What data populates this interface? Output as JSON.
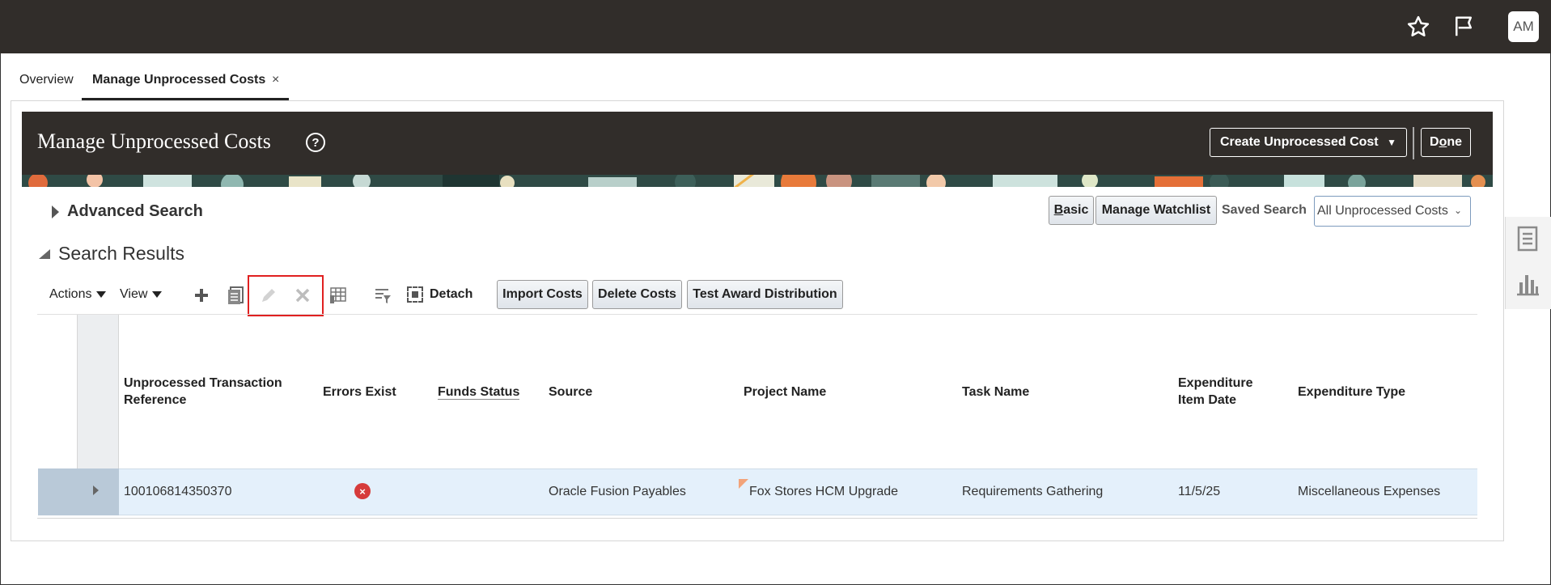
{
  "topbar": {
    "icons": [
      "star-icon",
      "flag-icon"
    ],
    "avatar_initials": "AM"
  },
  "tabs": [
    {
      "label": "Overview"
    },
    {
      "label": "Manage Unprocessed Costs",
      "active": true,
      "close": "×"
    }
  ],
  "page": {
    "title": "Manage Unprocessed Costs",
    "help": "?",
    "create_button": "Create Unprocessed Cost",
    "done_button": "Done"
  },
  "search": {
    "advanced_label": "Advanced Search",
    "basic_button": "Basic",
    "watchlist_button": "Manage Watchlist",
    "saved_search_label": "Saved Search",
    "saved_search_value": "All Unprocessed Costs"
  },
  "results": {
    "title": "Search Results",
    "toolbar": {
      "actions": "Actions",
      "view": "View",
      "detach": "Detach",
      "import": "Import Costs",
      "delete": "Delete Costs",
      "test_award": "Test Award Distribution"
    },
    "columns": {
      "ref": [
        "Unprocessed Transaction",
        "Reference"
      ],
      "errors": "Errors Exist",
      "funds": "Funds Status",
      "source": "Source",
      "project": "Project Name",
      "task": "Task Name",
      "date": [
        "Expenditure",
        "Item Date"
      ],
      "type": "Expenditure Type"
    },
    "rows": [
      {
        "ref": "100106814350370",
        "errors": "×",
        "funds": "",
        "source": "Oracle Fusion Payables",
        "project": "Fox Stores HCM Upgrade",
        "task": "Requirements Gathering",
        "date": "11/5/25",
        "type": "Miscellaneous Expenses"
      }
    ]
  },
  "colors": {
    "topbar": "#312d2a",
    "row_selected": "#e4f0fb",
    "error": "#d63b3b",
    "highlight": "#e02020"
  }
}
